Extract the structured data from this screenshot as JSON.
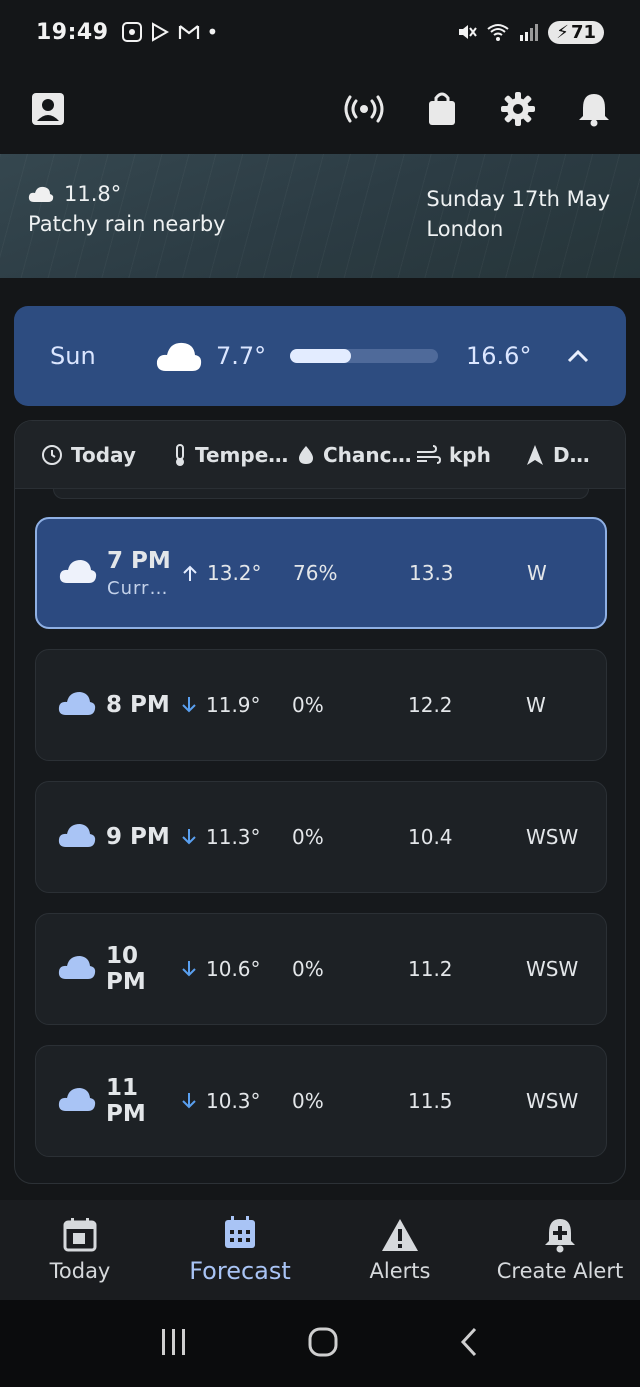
{
  "status_bar": {
    "time": "19:49",
    "battery": "71"
  },
  "hero": {
    "temperature": "11.8°",
    "condition": "Patchy rain nearby",
    "date": "Sunday 17th May",
    "location": "London"
  },
  "day_card": {
    "day": "Sun",
    "min_temp": "7.7°",
    "max_temp": "16.6°",
    "range_fill_fraction": 0.41
  },
  "table": {
    "headers": {
      "time": "Today",
      "temperature": "Tempe…",
      "chance": "Chanc…",
      "wind": "kph",
      "direction": "D…"
    },
    "rows": [
      {
        "time": "7 PM",
        "sub": "Curr…",
        "trend": "up",
        "temp": "13.2°",
        "chance": "76%",
        "wind": "13.3",
        "dir": "W",
        "current": true
      },
      {
        "time": "8 PM",
        "sub": "",
        "trend": "down",
        "temp": "11.9°",
        "chance": "0%",
        "wind": "12.2",
        "dir": "W",
        "current": false
      },
      {
        "time": "9 PM",
        "sub": "",
        "trend": "down",
        "temp": "11.3°",
        "chance": "0%",
        "wind": "10.4",
        "dir": "WSW",
        "current": false
      },
      {
        "time": "10 PM",
        "sub": "",
        "trend": "down",
        "temp": "10.6°",
        "chance": "0%",
        "wind": "11.2",
        "dir": "WSW",
        "current": false
      },
      {
        "time": "11 PM",
        "sub": "",
        "trend": "down",
        "temp": "10.3°",
        "chance": "0%",
        "wind": "11.5",
        "dir": "WSW",
        "current": false
      }
    ]
  },
  "bottom_nav": {
    "today": "Today",
    "forecast": "Forecast",
    "alerts": "Alerts",
    "create_alert": "Create Alert"
  },
  "colors": {
    "accent": "#a9c4f5",
    "current_row": "#2c4a80",
    "day_card": "#2d4c80",
    "trend_down": "#5aa0f0"
  }
}
